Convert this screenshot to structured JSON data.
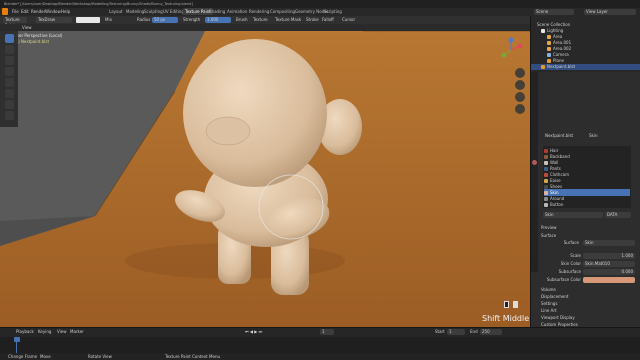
{
  "window": {
    "title": "Blender* [/Users/user/Desktop/Blender/Workshop/Modelling/Texturing/Bunny/Shade/Bunny_Texturing.blend]"
  },
  "menu": [
    "File",
    "Edit",
    "Render",
    "Window",
    "Help"
  ],
  "workspace_tabs": [
    "Layout",
    "Modeling",
    "Sculpting",
    "UV Editing",
    "Texture Paint",
    "Shading",
    "Animation",
    "Rendering",
    "Compositing",
    "Geometry Nodes",
    "Scripting"
  ],
  "active_tab": "Texture Paint",
  "top_right": {
    "scene": "Scene",
    "view_layer": "View Layer"
  },
  "tool_header": {
    "brush_name": "TexDraw",
    "mode": "Texture Paint",
    "radius": "Radius",
    "radius_value": "50 px",
    "strength": "Strength",
    "strength_value": "1.000",
    "brush": "Brush",
    "texture": "Texture",
    "texture_mask": "Texture Mask",
    "stroke": "Stroke",
    "falloff": "Falloff",
    "cursor": "Cursor",
    "mix": "Mix",
    "view": "View"
  },
  "viewport": {
    "perspective_label": "User Perspective (Local)",
    "object_label": "(1) Nextpaint.blst",
    "overlay_text": "Shift Middle"
  },
  "outliner": {
    "title": "Scene Collection",
    "items": [
      {
        "label": "Scene Collection",
        "indent": 0
      },
      {
        "label": "Lighting",
        "indent": 1
      },
      {
        "label": "Area",
        "indent": 2
      },
      {
        "label": "Area.001",
        "indent": 2
      },
      {
        "label": "Area.002",
        "indent": 2
      },
      {
        "label": "Camera",
        "indent": 2
      },
      {
        "label": "Plane",
        "indent": 2
      },
      {
        "label": "Nextpaint.blst",
        "indent": 1
      }
    ]
  },
  "properties": {
    "object_name": "Nextpaint.blst",
    "material_label": "Skin",
    "material_slots": [
      "Hair",
      "Backband",
      "Wall",
      "Pants",
      "Clothcam",
      "Eaise",
      "Shoes",
      "Skin",
      "Around",
      "Button"
    ],
    "selected_slot": "Skin",
    "slot_colors": [
      "#b13b2d",
      "#8a5a3b",
      "#c9c2b8",
      "#3b5e8a",
      "#c24a3a",
      "#d6a64a",
      "#4a4a4a",
      "#e0b39a",
      "#8a8a8a",
      "#b8b8b8"
    ],
    "material_field": "Skin",
    "data_field": "DATA",
    "sections": {
      "preview": "Preview",
      "surface": "Surface"
    },
    "surface_label": "Surface",
    "surface_value": "Skin",
    "fields": [
      {
        "label": "Scale",
        "value": "1.000"
      },
      {
        "label": "Skin Color",
        "value": "Skin.Mat010"
      },
      {
        "label": "Subsurface",
        "value": "0.000"
      },
      {
        "label": "Subsurface Color",
        "value": ""
      }
    ],
    "more_sections": [
      "Volume",
      "Displacement",
      "Settings",
      "Line Art",
      "Viewport Display",
      "Custom Properties"
    ]
  },
  "timeline": {
    "playback": "Playback",
    "keying": "Keying",
    "view": "View",
    "marker": "Marker",
    "start": "Start",
    "start_value": "1",
    "end": "End",
    "end_value": "250",
    "current": "1"
  },
  "status_bar": {
    "left": "Change Frame",
    "mid": "Move",
    "mid2": "Rotate View",
    "right": "Texture Paint Context Menu"
  },
  "colors": {
    "accent": "#4772b3",
    "floor": "#a8692f",
    "wall": "#555555",
    "skin": "#dcc2a3"
  }
}
